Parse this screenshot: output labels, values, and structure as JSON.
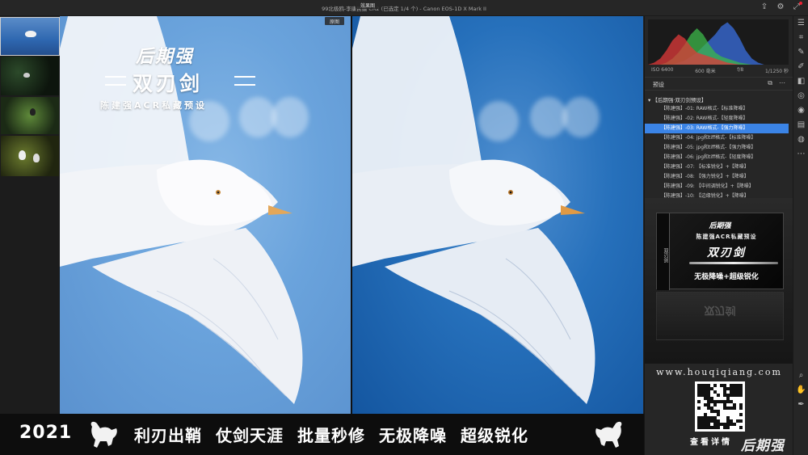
{
  "window": {
    "title": "99北极鸥-李康民摄 CR2 (已选定 1/4 个) - Canon EOS-1D X Mark II"
  },
  "compare": {
    "before_label": "原图",
    "after_label": "效果图"
  },
  "brand": {
    "logo": "后期强",
    "name": "双刃剑",
    "subtitle": "陈建强ACR私藏预设"
  },
  "exif": {
    "iso": "ISO 6400",
    "focal": "600 毫米",
    "aperture": "f/8",
    "shutter": "1/1250 秒"
  },
  "presets": {
    "title": "预设",
    "group": "【后期强·双刃剑预设】",
    "items": [
      "【陈建强】-01: RAW格式-【标准降噪】",
      "【陈建强】-02: RAW格式-【轻度降噪】",
      "【陈建强】-03: RAW格式-【强力降噪】",
      "【陈建强】-04: jpg和tiff格式-【标准降噪】",
      "【陈建强】-05: jpg和tiff格式-【强力降噪】",
      "【陈建强】-06: jpg和tiff格式-【轻度降噪】",
      "【陈建强】-07: 【标准锐化】+【降噪】",
      "【陈建强】-08: 【强力锐化】+【降噪】",
      "【陈建强】-09: 【中间调锐化】+【降噪】",
      "【陈建强】-10: 【边缘锐化】+【降噪】"
    ],
    "selected_index": 2
  },
  "product": {
    "logo": "后期强",
    "subtitle": "陈建强ACR私藏预设",
    "name": "双刃剑",
    "spine": "双刃剑",
    "feature": "无极降噪+超级锐化",
    "reflection": "双刃剑"
  },
  "promo": {
    "website": "www.houqiqiang.com",
    "qr_caption": "查看详情",
    "corner_logo": "后期强"
  },
  "banner": {
    "year": "2021",
    "slogans": [
      "利刃出鞘",
      "仗剑天涯",
      "批量秒修",
      "无极降噪",
      "超级锐化"
    ]
  },
  "histogram": {
    "red": [
      0,
      2,
      6,
      14,
      24,
      30,
      26,
      18,
      12,
      10,
      8,
      6,
      4,
      2,
      1,
      0,
      0,
      0,
      0,
      0,
      0,
      0,
      0,
      0
    ],
    "green": [
      0,
      0,
      0,
      2,
      6,
      12,
      20,
      30,
      36,
      30,
      20,
      12,
      8,
      6,
      4,
      2,
      1,
      0,
      0,
      0,
      0,
      0,
      0,
      0
    ],
    "blue": [
      0,
      0,
      0,
      0,
      0,
      2,
      4,
      8,
      12,
      18,
      24,
      30,
      38,
      42,
      36,
      26,
      14,
      6,
      2,
      0,
      0,
      0,
      0,
      0
    ]
  },
  "colors": {
    "accent": "#3b84e6",
    "hist_red": "#e03a3a",
    "hist_green": "#3cb84a",
    "hist_blue": "#3a6fe0"
  }
}
